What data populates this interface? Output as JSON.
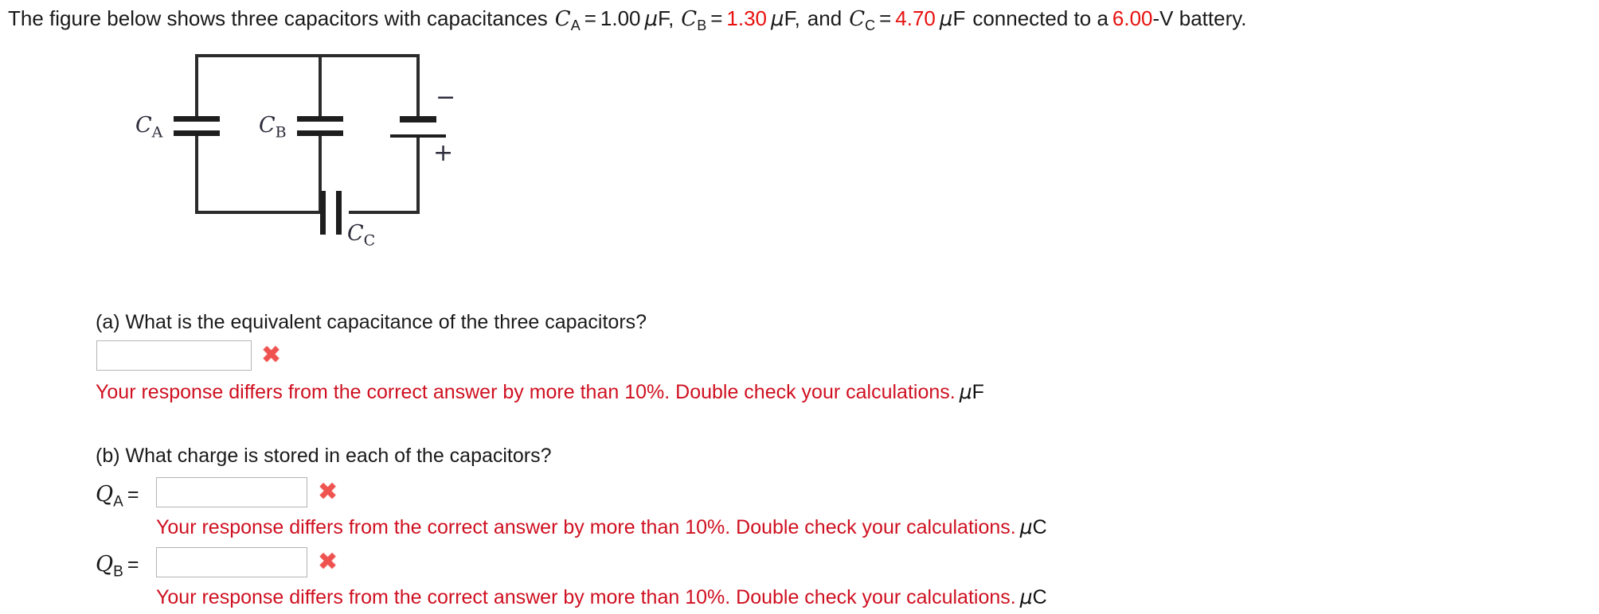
{
  "prompt": {
    "lead": "The figure below shows three capacitors with capacitances",
    "ca_symbol": "C",
    "ca_sub": "A",
    "ca_eq": "=",
    "ca_value": "1.00",
    "ca_unit": "F,",
    "cb_symbol": "C",
    "cb_sub": "B",
    "cb_eq": "=",
    "cb_value": "1.30",
    "cb_unit": "F,",
    "and_word": "and",
    "cc_symbol": "C",
    "cc_sub": "C",
    "cc_eq": "=",
    "cc_value": "4.70",
    "cc_unit": "F",
    "connected_text": "connected to a",
    "battery_value": "6.00",
    "battery_tail": "-V battery."
  },
  "figure": {
    "label_ca": "C",
    "label_ca_sub": "A",
    "label_cb": "C",
    "label_cb_sub": "B",
    "label_cc": "C",
    "label_cc_sub": "C",
    "battery_minus": "−",
    "battery_plus": "+",
    "wire_color": "#2b2b2b"
  },
  "questions": [
    {
      "id": "a",
      "text": "(a) What is the equivalent capacitance of the three capacitors?",
      "input_value": "",
      "input_placeholder": "",
      "mark": "✖",
      "feedback": "Your response differs from the correct answer by more than 10%. Double check your calculations.",
      "unit": "F"
    },
    {
      "id": "b",
      "text": "(b) What charge is stored in each of the capacitors?"
    }
  ],
  "charges": [
    {
      "symbol": "Q",
      "sub": "A",
      "eq": "=",
      "input_value": "",
      "input_placeholder": "",
      "mark": "✖",
      "feedback": "Your response differs from the correct answer by more than 10%. Double check your calculations.",
      "unit": "C"
    },
    {
      "symbol": "Q",
      "sub": "B",
      "eq": "=",
      "input_value": "",
      "input_placeholder": "",
      "mark": "✖",
      "feedback": "Your response differs from the correct answer by more than 10%. Double check your calculations.",
      "unit": "C"
    }
  ],
  "colors": {
    "error_red": "#cf1020",
    "value_red": "#e8110f",
    "mark_red": "#ef5350",
    "text_black": "#1a1a1a",
    "input_border": "#b4b4b4"
  }
}
